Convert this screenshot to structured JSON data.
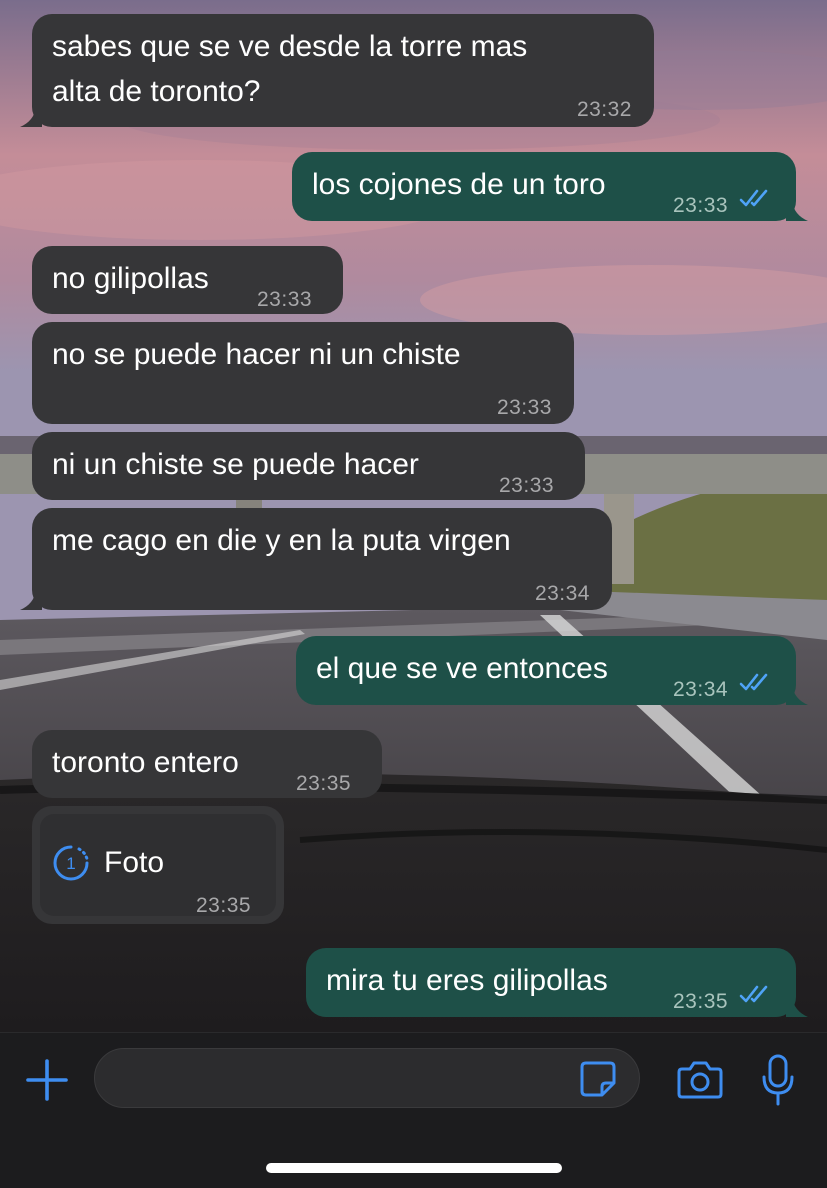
{
  "colors": {
    "incoming_bubble": "#363638",
    "outgoing_bubble": "#1e5048",
    "accent": "#3e8df0",
    "read_ticks": "#4fa3f7"
  },
  "messages": [
    {
      "direction": "in",
      "lines": [
        "sabes que se ve desde la torre mas",
        "alta de toronto?"
      ],
      "time": "23:32"
    },
    {
      "direction": "out",
      "text": "los cojones de un toro",
      "time": "23:33",
      "status": "read"
    },
    {
      "direction": "in",
      "text": "no gilipollas",
      "time": "23:33"
    },
    {
      "direction": "in",
      "text": "no se puede hacer ni un chiste",
      "time": "23:33"
    },
    {
      "direction": "in",
      "text": "ni un chiste se puede hacer",
      "time": "23:33"
    },
    {
      "direction": "in",
      "text": "me cago en die y en la puta virgen",
      "time": "23:34"
    },
    {
      "direction": "out",
      "text": "el que se ve entonces",
      "time": "23:34",
      "status": "read"
    },
    {
      "direction": "in",
      "text": "toronto entero",
      "time": "23:35"
    },
    {
      "direction": "in",
      "type": "view-once-photo",
      "badge": "1",
      "text": "Foto",
      "time": "23:35"
    },
    {
      "direction": "out",
      "text": "mira tu eres gilipollas",
      "time": "23:35",
      "status": "read"
    }
  ],
  "composer": {
    "placeholder": "",
    "value": "",
    "icons": [
      "plus-icon",
      "sticker-icon",
      "camera-icon",
      "microphone-icon"
    ]
  }
}
